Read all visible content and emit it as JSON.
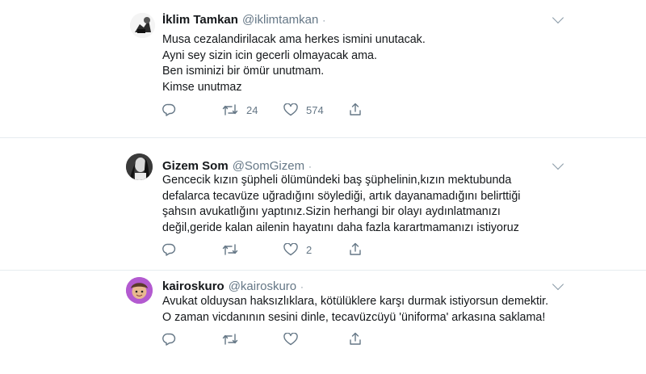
{
  "tweets": [
    {
      "name": "İklim Tamkan",
      "handle": "@iklimtamkan",
      "dot": "·",
      "lines": [
        "Musa cezalandirilacak ama herkes ismini unutacak.",
        "Ayni sey sizin icin gecerli olmayacak ama.",
        "Ben isminizi bir ömür unutmam.",
        "Kimse unutmaz"
      ],
      "retweets": "24",
      "likes": "574"
    },
    {
      "name": "Gizem Som",
      "handle": "@SomGizem",
      "dot": "·",
      "lines": [
        "Gencecik kızın şüpheli ölümündeki baş şüphelinin,kızın mektubunda",
        "defalarca tecavüze uğradığını söylediği, artık dayanamadığını belirttiği",
        "şahsın avukatlığını yaptınız.Sizin herhangi bir olayı aydınlatmanızı",
        "değil,geride kalan ailenin hayatını daha fazla karartmamanızı istiyoruz"
      ],
      "retweets": "",
      "likes": "2"
    },
    {
      "name": "kairoskuro",
      "handle": "@kairoskuro",
      "dot": "·",
      "lines": [
        "Avukat olduysan haksızlıklara, kötülüklere karşı durmak istiyorsun demektir.",
        "O zaman vicdanının sesini dinle, tecavüzcüyü 'üniforma' arkasına saklama!"
      ],
      "retweets": "",
      "likes": ""
    }
  ],
  "icons": {
    "reply": "reply-icon",
    "retweet": "retweet-icon",
    "like": "heart-icon",
    "share": "share-icon",
    "more": "chevron-down-icon"
  },
  "colors": {
    "text": "#14171a",
    "secondary": "#657786",
    "separator": "#e6ecf0"
  }
}
